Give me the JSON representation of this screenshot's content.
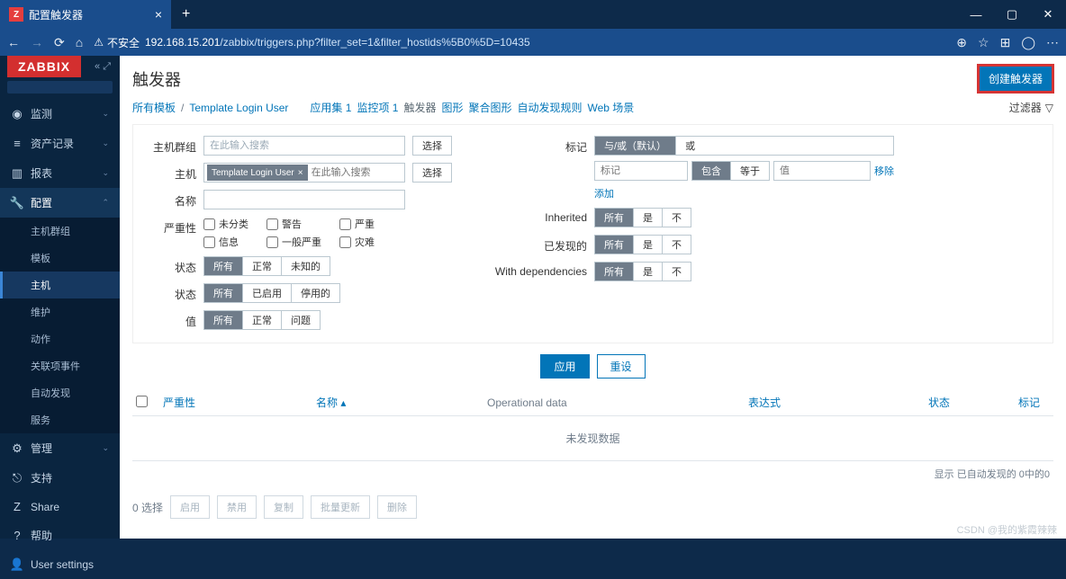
{
  "browser": {
    "tab_title": "配置触发器",
    "insecure_label": "不安全",
    "url_host": "192.168.15.201",
    "url_path": "/zabbix/triggers.php?filter_set=1&filter_hostids%5B0%5D=10435"
  },
  "brand": "ZABBIX",
  "sidebar": {
    "top": [
      {
        "icon": "◉",
        "label": "监测"
      },
      {
        "icon": "≡",
        "label": "资产记录"
      },
      {
        "icon": "▥",
        "label": "报表"
      },
      {
        "icon": "🔧",
        "label": "配置"
      }
    ],
    "config_sub": [
      "主机群组",
      "模板",
      "主机",
      "维护",
      "动作",
      "关联项事件",
      "自动发现",
      "服务"
    ],
    "admin": {
      "icon": "⚙",
      "label": "管理"
    },
    "bottom": [
      {
        "icon": "⎋",
        "label": "支持"
      },
      {
        "icon": "Z",
        "label": "Share"
      },
      {
        "icon": "?",
        "label": "帮助"
      },
      {
        "icon": "👤",
        "label": "User settings"
      }
    ]
  },
  "page": {
    "title": "触发器",
    "create_label": "创建触发器",
    "breadcrumb_all": "所有模板",
    "breadcrumb_template": "Template Login User",
    "tabs": [
      "应用集 1",
      "监控项 1",
      "触发器",
      "图形",
      "聚合图形",
      "自动发现规则",
      "Web 场景"
    ],
    "filter_label": "过滤器"
  },
  "filter": {
    "hostgroup_label": "主机群组",
    "host_label": "主机",
    "name_label": "名称",
    "severity_label": "严重性",
    "state_label": "状态",
    "status_label": "状态",
    "value_label": "值",
    "placeholder_search": "在此输入搜索",
    "select_btn": "选择",
    "host_chip": "Template Login User",
    "severities": {
      "c1": [
        "未分类",
        "信息"
      ],
      "c2": [
        "警告",
        "一般严重"
      ],
      "c3": [
        "严重",
        "灾难"
      ]
    },
    "seg_all": "所有",
    "seg_normal": "正常",
    "seg_unknown": "未知的",
    "seg_enabled": "已启用",
    "seg_disabled": "停用的",
    "seg_problem": "问题",
    "tags_label": "标记",
    "and_or": "与/或（默认）",
    "or": "或",
    "tag_placeholder": "标记",
    "contains": "包含",
    "equals": "等于",
    "value_placeholder": "值",
    "remove": "移除",
    "add": "添加",
    "inherited_label": "Inherited",
    "discovered_label": "已发现的",
    "withdep_label": "With dependencies",
    "yes": "是",
    "no": "不",
    "apply": "应用",
    "reset": "重设"
  },
  "table": {
    "col_severity": "严重性",
    "col_name": "名称 ▴",
    "col_opdata": "Operational data",
    "col_expr": "表达式",
    "col_status": "状态",
    "col_tags": "标记",
    "no_data": "未发现数据",
    "footer": "显示 已自动发现的 0中的0"
  },
  "bulk": {
    "count": "0 选择",
    "enable": "启用",
    "disable": "禁用",
    "copy": "复制",
    "massupdate": "批量更新",
    "delete": "删除"
  },
  "watermark": "CSDN @我的紫霞辣辣"
}
